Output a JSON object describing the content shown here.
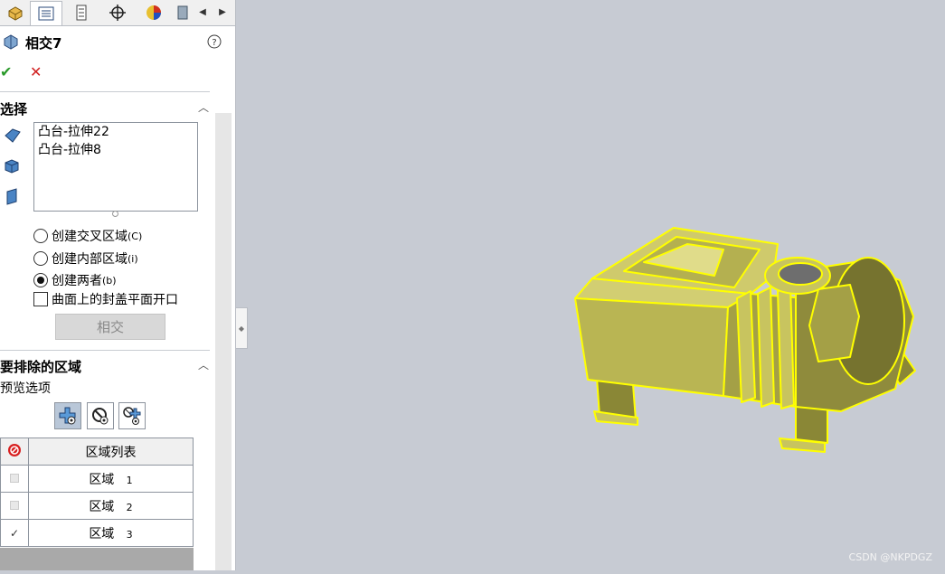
{
  "feature": {
    "title": "相交7",
    "help": "?"
  },
  "actions": {
    "ok": "✔",
    "cancel": "✕"
  },
  "selection": {
    "heading": "选择",
    "items": [
      "凸台-拉伸22",
      "凸台-拉伸8"
    ]
  },
  "options": {
    "create_intersect": {
      "label": "创建交叉区域",
      "key": "(C)",
      "selected": false
    },
    "create_internal": {
      "label": "创建内部区域",
      "key": "(i)",
      "selected": false
    },
    "create_both": {
      "label": "创建两者",
      "key": "(b)",
      "selected": true
    },
    "cap_planar": {
      "label": "曲面上的封盖平面开口",
      "checked": false
    }
  },
  "intersect_button": "相交",
  "exclude": {
    "heading": "要排除的区域",
    "preview_label": "预览选项"
  },
  "region_table": {
    "header": "区域列表",
    "rows": [
      {
        "name": "区域",
        "num": "1",
        "checked": false
      },
      {
        "name": "区域",
        "num": "2",
        "checked": false
      },
      {
        "name": "区域",
        "num": "3",
        "checked": true
      }
    ]
  },
  "watermark": "CSDN @NKPDGZ",
  "colors": {
    "model": "#c8c45f",
    "model_dark": "#8a8736",
    "edge": "#ffff00",
    "background": "#c7cbd3"
  }
}
